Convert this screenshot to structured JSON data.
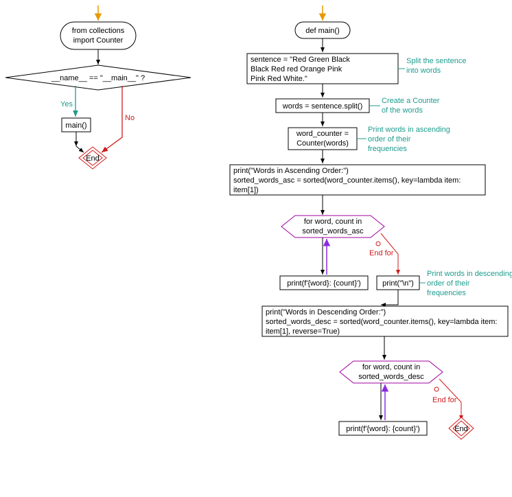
{
  "left": {
    "start_box": "from collections\nimport Counter",
    "decision": "__name__ == \"__main__\" ?",
    "yes": "Yes",
    "no": "No",
    "call": "main()",
    "end": "End"
  },
  "right": {
    "def": "def main()",
    "sentence_box": "sentence = \"Red Green Black\nBlack Red red Orange Pink\nPink Red White.\"",
    "ann1": "Split the sentence\ninto words",
    "words_box": "words = sentence.split()",
    "ann2": "Create a Counter\nof the words",
    "counter_box": "word_counter =\nCounter(words)",
    "ann3": "Print words in ascending\norder of their\nfrequencies",
    "asc_box": "print(\"Words in Ascending Order:\")\nsorted_words_asc = sorted(word_counter.items(), key=lambda item:\nitem[1])",
    "for_asc": "for word, count in\nsorted_words_asc",
    "print_word_asc": "print(f'{word}: {count}')",
    "print_newline": "print(\"\\n\")",
    "ann4": "Print words in descending\norder of their\nfrequencies",
    "endfor1": "End for",
    "desc_box": "print(\"Words in Descending Order:\")\nsorted_words_desc = sorted(word_counter.items(), key=lambda item:\nitem[1], reverse=True)",
    "for_desc": "for word, count in\nsorted_words_desc",
    "endfor2": "End for",
    "print_word_desc": "print(f'{word}: {count}')",
    "end": "End"
  }
}
